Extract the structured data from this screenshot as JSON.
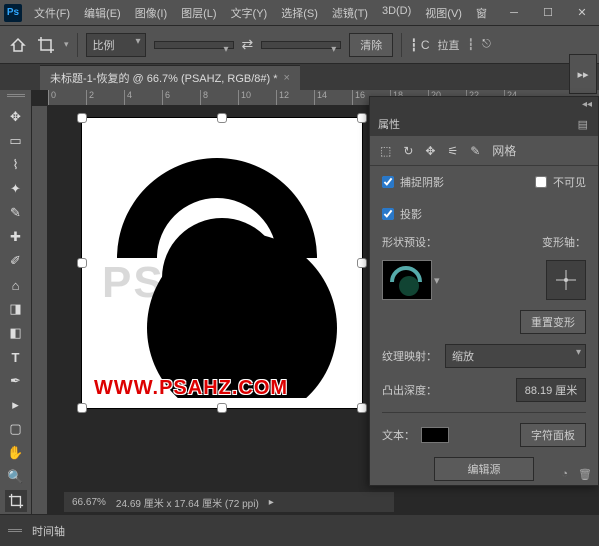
{
  "app": {
    "logo": "Ps"
  },
  "menu": {
    "file": "文件(F)",
    "edit": "编辑(E)",
    "image": "图像(I)",
    "layer": "图层(L)",
    "type": "文字(Y)",
    "select": "选择(S)",
    "filter": "滤镜(T)",
    "d3": "3D(D)",
    "view": "视图(V)",
    "window": "窗",
    "help": " "
  },
  "toolbar": {
    "ratio_label": "比例",
    "clear_label": "清除",
    "straighten_label": "拉直"
  },
  "tab": {
    "title": "未标题-1-恢复的 @ 66.7% (PSAHZ, RGB/8#) *"
  },
  "ruler": {
    "m0": "0",
    "m2": "2",
    "m4": "4",
    "m6": "6",
    "m8": "8",
    "m10": "10",
    "m12": "12",
    "m14": "14",
    "m16": "16",
    "m18": "18",
    "m20": "20",
    "m22": "22",
    "m24": "24"
  },
  "canvas": {
    "bg_text": "PSA",
    "watermark": "WWW.PSAHZ.COM"
  },
  "props": {
    "title": "属性",
    "tab_mesh": "网格",
    "chk_shadow": "捕捉阴影",
    "chk_invisible": "不可见",
    "chk_cast": "投影",
    "shape_preset": "形状预设：",
    "deform_axis": "变形轴：",
    "reset_deform": "重置变形",
    "texture_map": "纹理映射：",
    "texture_value": "缩放",
    "extrude_depth": "凸出深度：",
    "extrude_value": "88.19 厘米",
    "text_label": "文本：",
    "char_panel": "字符面板",
    "edit_source": "编辑源"
  },
  "status": {
    "zoom": "66.67%",
    "docinfo": "24.69 厘米 x 17.64 厘米 (72 ppi)"
  },
  "timeline": {
    "label": "时间轴"
  }
}
